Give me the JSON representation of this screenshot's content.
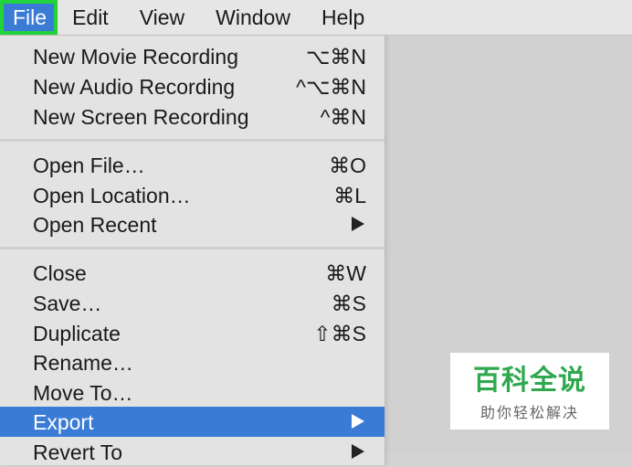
{
  "menubar": {
    "items": [
      {
        "label": "File",
        "active": true
      },
      {
        "label": "Edit"
      },
      {
        "label": "View"
      },
      {
        "label": "Window"
      },
      {
        "label": "Help"
      }
    ]
  },
  "file_menu": {
    "groups": [
      [
        {
          "label": "New Movie Recording",
          "shortcut": "⌥⌘N"
        },
        {
          "label": "New Audio Recording",
          "shortcut": "^⌥⌘N"
        },
        {
          "label": "New Screen Recording",
          "shortcut": "^⌘N"
        }
      ],
      [
        {
          "label": "Open File…",
          "shortcut": "⌘O"
        },
        {
          "label": "Open Location…",
          "shortcut": "⌘L"
        },
        {
          "label": "Open Recent",
          "submenu": true
        }
      ],
      [
        {
          "label": "Close",
          "shortcut": "⌘W"
        },
        {
          "label": "Save…",
          "shortcut": "⌘S"
        },
        {
          "label": "Duplicate",
          "shortcut": "⇧⌘S"
        },
        {
          "label": "Rename…"
        },
        {
          "label": "Move To…"
        },
        {
          "label": "Export",
          "submenu": true,
          "highlighted": true
        },
        {
          "label": "Revert To",
          "submenu": true
        }
      ]
    ]
  },
  "watermark": {
    "main": "百科全说",
    "sub": "助你轻松解决"
  },
  "colors": {
    "highlight": "#3a7bd5",
    "file_outline": "#22d43c",
    "watermark_green": "#2fa84f"
  }
}
